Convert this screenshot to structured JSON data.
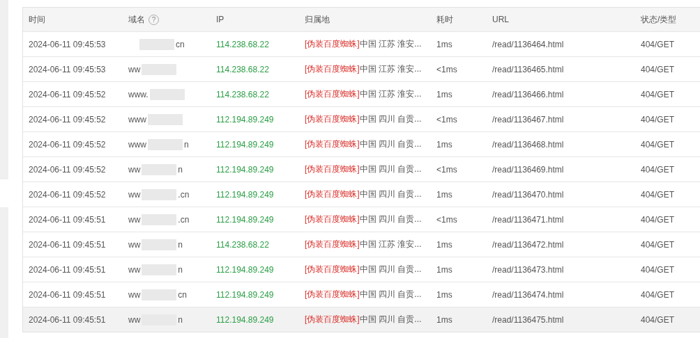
{
  "table": {
    "columns": [
      {
        "label": "时间"
      },
      {
        "label": "域名",
        "help": "?"
      },
      {
        "label": "IP"
      },
      {
        "label": "归属地"
      },
      {
        "label": "耗时"
      },
      {
        "label": "URL"
      },
      {
        "label": "状态/类型"
      }
    ],
    "rows": [
      {
        "time": "2024-06-11 09:45:53",
        "domain_start": "",
        "domain_end": "cn",
        "ip": "114.238.68.22",
        "tag": "[伪装百度蜘蛛]",
        "place": "中国 江苏 淮安...",
        "duration": "1ms",
        "url": "/read/1136464.html",
        "status": "404/GET",
        "highlighted": false
      },
      {
        "time": "2024-06-11 09:45:53",
        "domain_start": "ww",
        "domain_end": "",
        "ip": "114.238.68.22",
        "tag": "[伪装百度蜘蛛]",
        "place": "中国 江苏 淮安...",
        "duration": "<1ms",
        "url": "/read/1136465.html",
        "status": "404/GET",
        "highlighted": false
      },
      {
        "time": "2024-06-11 09:45:52",
        "domain_start": "www.",
        "domain_end": "",
        "ip": "114.238.68.22",
        "tag": "[伪装百度蜘蛛]",
        "place": "中国 江苏 淮安...",
        "duration": "1ms",
        "url": "/read/1136466.html",
        "status": "404/GET",
        "highlighted": false
      },
      {
        "time": "2024-06-11 09:45:52",
        "domain_start": "www",
        "domain_end": "",
        "ip": "112.194.89.249",
        "tag": "[伪装百度蜘蛛]",
        "place": "中国 四川 自贡...",
        "duration": "<1ms",
        "url": "/read/1136467.html",
        "status": "404/GET",
        "highlighted": false
      },
      {
        "time": "2024-06-11 09:45:52",
        "domain_start": "www",
        "domain_end": "n",
        "ip": "112.194.89.249",
        "tag": "[伪装百度蜘蛛]",
        "place": "中国 四川 自贡...",
        "duration": "1ms",
        "url": "/read/1136468.html",
        "status": "404/GET",
        "highlighted": false
      },
      {
        "time": "2024-06-11 09:45:52",
        "domain_start": "ww",
        "domain_end": "n",
        "ip": "112.194.89.249",
        "tag": "[伪装百度蜘蛛]",
        "place": "中国 四川 自贡...",
        "duration": "<1ms",
        "url": "/read/1136469.html",
        "status": "404/GET",
        "highlighted": false
      },
      {
        "time": "2024-06-11 09:45:52",
        "domain_start": "ww",
        "domain_end": ".cn",
        "ip": "112.194.89.249",
        "tag": "[伪装百度蜘蛛]",
        "place": "中国 四川 自贡...",
        "duration": "1ms",
        "url": "/read/1136470.html",
        "status": "404/GET",
        "highlighted": false
      },
      {
        "time": "2024-06-11 09:45:51",
        "domain_start": "ww",
        "domain_end": ".cn",
        "ip": "112.194.89.249",
        "tag": "[伪装百度蜘蛛]",
        "place": "中国 四川 自贡...",
        "duration": "<1ms",
        "url": "/read/1136471.html",
        "status": "404/GET",
        "highlighted": false
      },
      {
        "time": "2024-06-11 09:45:51",
        "domain_start": "ww",
        "domain_end": "n",
        "ip": "114.238.68.22",
        "tag": "[伪装百度蜘蛛]",
        "place": "中国 江苏 淮安...",
        "duration": "1ms",
        "url": "/read/1136472.html",
        "status": "404/GET",
        "highlighted": false
      },
      {
        "time": "2024-06-11 09:45:51",
        "domain_start": "ww",
        "domain_end": "n",
        "ip": "112.194.89.249",
        "tag": "[伪装百度蜘蛛]",
        "place": "中国 四川 自贡...",
        "duration": "1ms",
        "url": "/read/1136473.html",
        "status": "404/GET",
        "highlighted": false
      },
      {
        "time": "2024-06-11 09:45:51",
        "domain_start": "ww",
        "domain_end": "cn",
        "ip": "112.194.89.249",
        "tag": "[伪装百度蜘蛛]",
        "place": "中国 四川 自贡...",
        "duration": "1ms",
        "url": "/read/1136474.html",
        "status": "404/GET",
        "highlighted": false
      },
      {
        "time": "2024-06-11 09:45:51",
        "domain_start": "ww",
        "domain_end": "n",
        "ip": "112.194.89.249",
        "tag": "[伪装百度蜘蛛]",
        "place": "中国 四川 自贡...",
        "duration": "1ms",
        "url": "/read/1136475.html",
        "status": "404/GET",
        "highlighted": true
      }
    ]
  }
}
